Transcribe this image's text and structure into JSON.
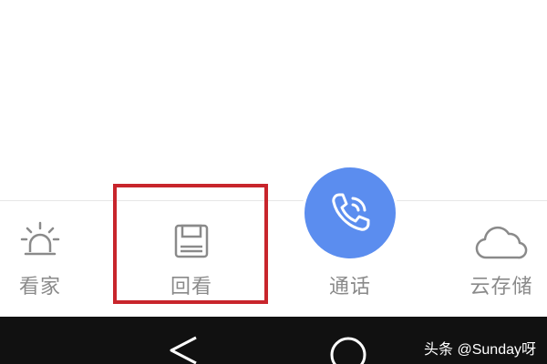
{
  "tabbar": {
    "tabs": [
      {
        "id": "home",
        "label": "看家",
        "icon": "alarm-light-icon"
      },
      {
        "id": "playback",
        "label": "回看",
        "icon": "floppy-disk-icon"
      },
      {
        "id": "call",
        "label": "通话",
        "icon": "phone-icon"
      },
      {
        "id": "cloud",
        "label": "云存储",
        "icon": "cloud-icon"
      }
    ]
  },
  "highlight": {
    "target": "playback",
    "color": "#c8252c"
  },
  "call_button": {
    "color": "#5b8def"
  },
  "system_nav": {
    "buttons": [
      {
        "id": "back",
        "icon": "back-triangle-icon"
      },
      {
        "id": "home",
        "icon": "home-circle-icon"
      }
    ]
  },
  "watermark": {
    "text": "头条 @Sunday呀"
  }
}
